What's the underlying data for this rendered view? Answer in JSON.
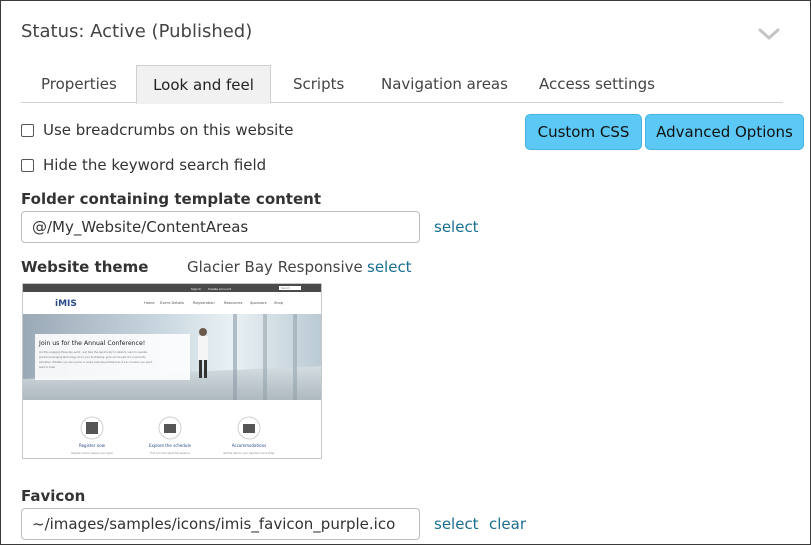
{
  "header": {
    "status_title": "Status: Active (Published)"
  },
  "tabs": [
    {
      "label": "Properties"
    },
    {
      "label": "Look and feel"
    },
    {
      "label": "Scripts"
    },
    {
      "label": "Navigation areas"
    },
    {
      "label": "Access settings"
    }
  ],
  "active_tab": "Look and feel",
  "options": {
    "breadcrumbs_label": "Use breadcrumbs on this website",
    "breadcrumbs_checked": false,
    "hide_search_label": "Hide the keyword search field",
    "hide_search_checked": false
  },
  "buttons": {
    "custom_css": "Custom CSS",
    "advanced_options": "Advanced Options"
  },
  "folder": {
    "label": "Folder containing template content",
    "value": "@/My_Website/ContentAreas",
    "select_label": "select"
  },
  "theme": {
    "label": "Website theme",
    "name": "Glacier Bay Responsive",
    "select_label": "select",
    "preview": {
      "logo": "iMIS",
      "top_links": [
        "Sign In",
        "Create account"
      ],
      "search_placeholder": "Search",
      "nav": [
        "Home",
        "Event Details",
        "Registration",
        "Resources",
        "Sponsors",
        "Shop"
      ],
      "hero_title": "Join us for the Annual Conference!",
      "hero_lines": [
        "Join this engaging three-day event - and take the opportunity to network, learn to operate",
        "practice leveraging technology. Go to your fundraising; grow and be part of a community",
        "education. Whether you are a junior or senior business professional, it's an occasion you won't",
        "want to miss!"
      ],
      "features": [
        {
          "title": "Register now",
          "caption": "Register now to reserve your spot!"
        },
        {
          "title": "Explore the schedule",
          "caption": "Find out more about the sessions"
        },
        {
          "title": "Accommodations",
          "caption": "Get the rate for your selected rooms today"
        }
      ]
    }
  },
  "favicon": {
    "label": "Favicon",
    "value": "~/images/samples/icons/imis_favicon_purple.ico",
    "select_label": "select",
    "clear_label": "clear"
  },
  "colors": {
    "accent_button": "#5bc8f5",
    "link": "#1a6f91",
    "preview_logo": "#2a4a8a"
  }
}
